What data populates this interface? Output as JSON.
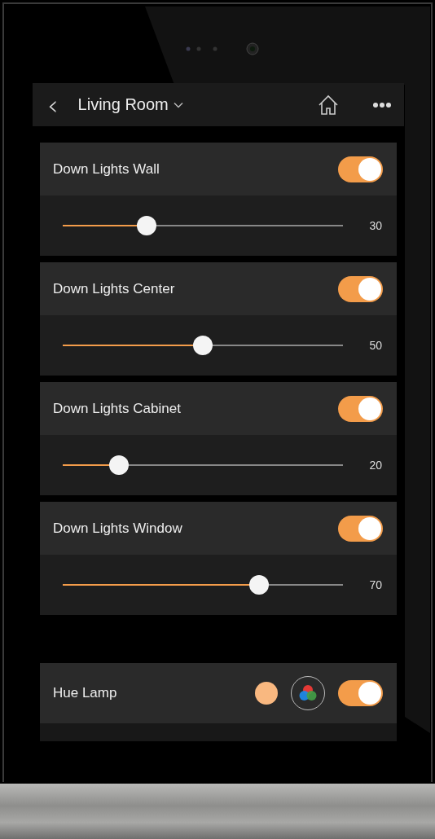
{
  "header": {
    "back": "‹",
    "title": "Living Room"
  },
  "lights": [
    {
      "kind": "dimmer",
      "name": "Down Lights Wall",
      "on": true,
      "level": 0.3,
      "reading": "30"
    },
    {
      "kind": "dimmer",
      "name": "Down Lights Center",
      "on": true,
      "level": 0.5,
      "reading": "50"
    },
    {
      "kind": "dimmer",
      "name": "Down Lights Cabinet",
      "on": true,
      "level": 0.2,
      "reading": "20"
    },
    {
      "kind": "dimmer",
      "name": "Down Lights Window",
      "on": true,
      "level": 0.7,
      "reading": "70"
    },
    {
      "kind": "color",
      "name": "Hue Lamp",
      "on": true,
      "color": "#f9b880"
    }
  ]
}
